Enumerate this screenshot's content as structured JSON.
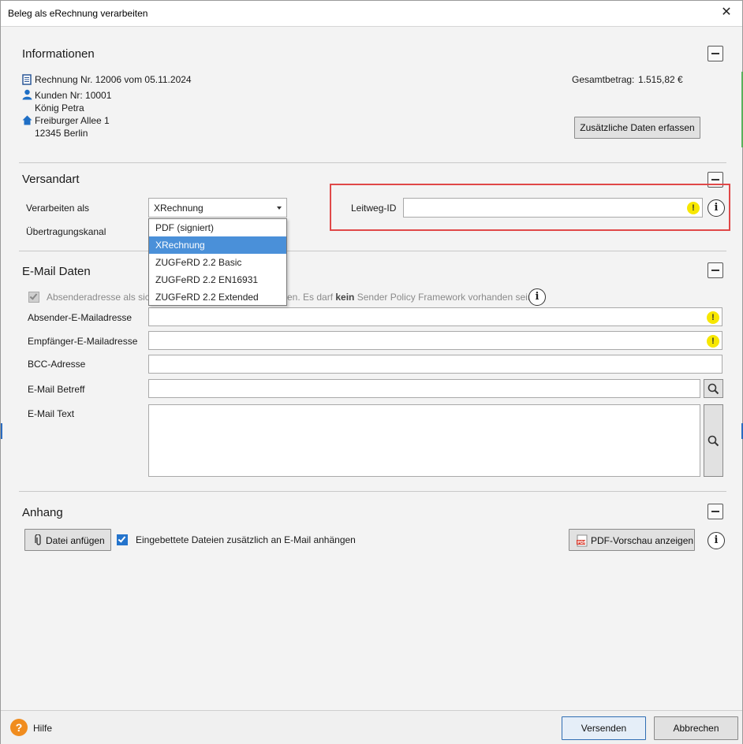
{
  "window": {
    "title": "Beleg als eRechnung verarbeiten",
    "close_label": "✕"
  },
  "informationen": {
    "title": "Informationen",
    "invoice": "Rechnung Nr. 12006 vom 05.11.2024",
    "customer_no": "Kunden Nr: 10001",
    "customer_name": "König Petra",
    "street": "Freiburger Allee 1",
    "city": "12345 Berlin",
    "total_label": "Gesamtbetrag:",
    "total_value": "1.515,82 €",
    "extra_button": "Zusätzliche Daten erfassen"
  },
  "versandart": {
    "title": "Versandart",
    "process_label": "Verarbeiten als",
    "channel_label": "Übertragungskanal",
    "selected": "XRechnung",
    "options": [
      "PDF (signiert)",
      "XRechnung",
      "ZUGFeRD 2.2 Basic",
      "ZUGFeRD 2.2 EN16931",
      "ZUGFeRD 2.2 Extended"
    ],
    "leitweg_label": "Leitweg-ID",
    "leitweg_value": ""
  },
  "email": {
    "title": "E-Mail Daten",
    "checkbox_text_visible_left": "Absenderadresse als sich",
    "checkbox_text_visible_right_a": "en. Es darf ",
    "checkbox_text_bold": "kein",
    "checkbox_text_visible_right_b": " Sender Policy Framework vorhanden sein.",
    "sender_label": "Absender-E-Mailadresse",
    "recipient_label": "Empfänger-E-Mailadresse",
    "bcc_label": "BCC-Adresse",
    "subject_label": "E-Mail Betreff",
    "text_label": "E-Mail Text"
  },
  "anhang": {
    "title": "Anhang",
    "attach_button": "Datei anfügen",
    "embed_checkbox_label": "Eingebettete Dateien zusätzlich an E-Mail anhängen",
    "preview_button": "PDF-Vorschau anzeigen"
  },
  "footer": {
    "help_label": "Hilfe",
    "send_button": "Versenden",
    "cancel_button": "Abbrechen"
  },
  "colors": {
    "accent": "#4a90d9",
    "highlight": "#e04848",
    "warn": "#f7e700",
    "help": "#f08c1e"
  }
}
